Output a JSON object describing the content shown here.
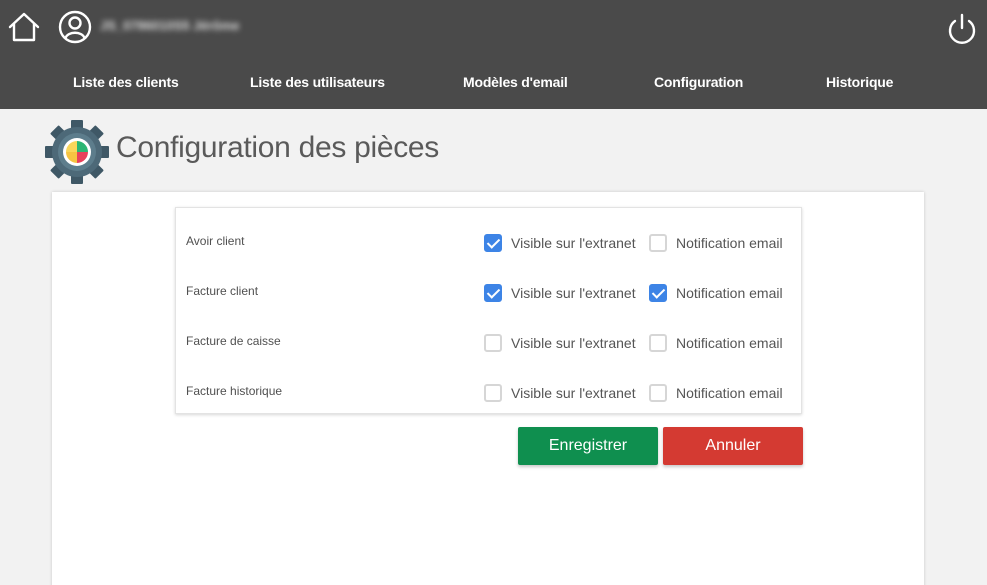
{
  "header": {
    "user_name": "JS_0786010S5 Jérôme",
    "nav": [
      {
        "label": "Liste des clients"
      },
      {
        "label": "Liste des utilisateurs"
      },
      {
        "label": "Modèles d'email"
      },
      {
        "label": "Configuration"
      },
      {
        "label": "Historique"
      }
    ],
    "icons": {
      "home": "home-icon",
      "user": "user-avatar-icon",
      "power": "power-icon"
    }
  },
  "page": {
    "title": "Configuration des pièces",
    "icon": "gear-icon"
  },
  "pieces": [
    {
      "label": "Avoir client",
      "extranet_label": "Visible sur l'extranet",
      "extranet": true,
      "notif_label": "Notification email",
      "notification": false
    },
    {
      "label": "Facture client",
      "extranet_label": "Visible sur l'extranet",
      "extranet": true,
      "notif_label": "Notification email",
      "notification": true
    },
    {
      "label": "Facture de caisse",
      "extranet_label": "Visible sur l'extranet",
      "extranet": false,
      "notif_label": "Notification email",
      "notification": false
    },
    {
      "label": "Facture historique",
      "extranet_label": "Visible sur l'extranet",
      "extranet": false,
      "notif_label": "Notification email",
      "notification": false
    }
  ],
  "actions": {
    "save_label": "Enregistrer",
    "cancel_label": "Annuler"
  },
  "colors": {
    "header_bg": "#4a4a4a",
    "checkbox_checked": "#3d84e6",
    "save": "#0f8f4f",
    "cancel": "#d43a32"
  }
}
